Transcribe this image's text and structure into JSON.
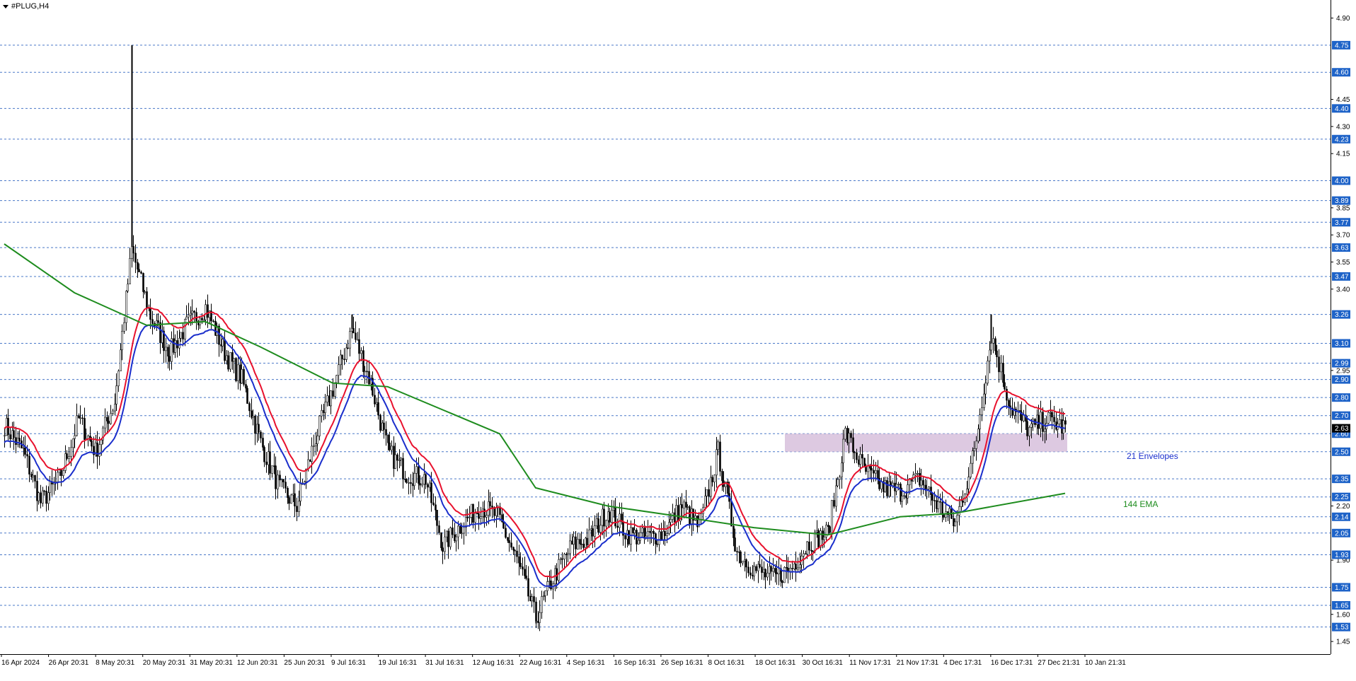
{
  "window": {
    "symbol": "#PLUG,H4"
  },
  "colors": {
    "candle": "#000000",
    "grid": "#4a78c8",
    "upper_band": "#e8112d",
    "lower_band": "#1a2ecc",
    "ema": "#1e8c1e",
    "zone": "#d7bfdc",
    "axis": "#000000",
    "highlight_label_bg": "#1e63c8"
  },
  "price_axis": {
    "min": 1.38,
    "max": 5.0,
    "tick_labels": [
      "4.90",
      "4.45",
      "4.30",
      "4.15",
      "3.85",
      "3.70",
      "3.55",
      "3.40",
      "2.95",
      "2.20",
      "1.90",
      "1.60",
      "1.45"
    ],
    "level_labels": [
      "4.75",
      "4.60",
      "4.40",
      "4.23",
      "4.00",
      "3.89",
      "3.77",
      "3.63",
      "3.47",
      "3.26",
      "3.10",
      "2.99",
      "2.90",
      "2.80",
      "2.70",
      "2.60",
      "2.50",
      "2.35",
      "2.25",
      "2.14",
      "2.05",
      "1.93",
      "1.75",
      "1.65",
      "1.53"
    ],
    "current_price": "2.63"
  },
  "time_axis": {
    "labels": [
      "16 Apr 2024",
      "26 Apr 20:31",
      "8 May 20:31",
      "20 May 20:31",
      "31 May 20:31",
      "12 Jun 20:31",
      "25 Jun 20:31",
      "9 Jul 16:31",
      "19 Jul 16:31",
      "31 Jul 16:31",
      "12 Aug 16:31",
      "22 Aug 16:31",
      "4 Sep 16:31",
      "16 Sep 16:31",
      "26 Sep 16:31",
      "8 Oct 16:31",
      "18 Oct 16:31",
      "30 Oct 16:31",
      "11 Nov 17:31",
      "21 Nov 17:31",
      "4 Dec 17:31",
      "16 Dec 17:31",
      "27 Dec 21:31",
      "10 Jan 21:31"
    ]
  },
  "zone": {
    "from": 2.5,
    "to": 2.6
  },
  "annotations": {
    "envelopes_label": "21 Envelopes",
    "ema_label": "144 EMA"
  },
  "chart_data": {
    "type": "candlestick",
    "series": [
      {
        "name": "21 Envelopes"
      },
      {
        "name": "144 EMA"
      }
    ],
    "keypoints": [
      {
        "date": "16 Apr 2024",
        "close": 2.65
      },
      {
        "date": "20 Apr",
        "close": 2.5
      },
      {
        "date": "24 Apr",
        "close": 2.22
      },
      {
        "date": "28 Apr",
        "close": 2.35
      },
      {
        "date": "2 May",
        "close": 2.68
      },
      {
        "date": "6 May",
        "close": 2.5
      },
      {
        "date": "8 May",
        "close": 2.78
      },
      {
        "date": "10 May",
        "close": 3.62
      },
      {
        "date": "14 May",
        "close": 3.25
      },
      {
        "date": "20 May",
        "close": 3.05
      },
      {
        "date": "26 May",
        "close": 3.2
      },
      {
        "date": "31 May",
        "close": 3.3
      },
      {
        "date": "6 Jun",
        "close": 3.05
      },
      {
        "date": "12 Jun",
        "close": 2.9
      },
      {
        "date": "18 Jun",
        "close": 2.55
      },
      {
        "date": "25 Jun",
        "close": 2.3
      },
      {
        "date": "30 Jun",
        "close": 2.2
      },
      {
        "date": "4 Jul",
        "close": 2.58
      },
      {
        "date": "9 Jul",
        "close": 2.85
      },
      {
        "date": "13 Jul",
        "close": 3.18
      },
      {
        "date": "16 Jul",
        "close": 2.88
      },
      {
        "date": "19 Jul",
        "close": 2.5
      },
      {
        "date": "25 Jul",
        "close": 2.38
      },
      {
        "date": "31 Jul",
        "close": 2.35
      },
      {
        "date": "5 Aug",
        "close": 1.98
      },
      {
        "date": "12 Aug",
        "close": 2.1
      },
      {
        "date": "17 Aug",
        "close": 2.2
      },
      {
        "date": "22 Aug",
        "close": 2.14
      },
      {
        "date": "28 Aug",
        "close": 1.9
      },
      {
        "date": "4 Sep",
        "close": 1.58
      },
      {
        "date": "8 Sep",
        "close": 1.8
      },
      {
        "date": "16 Sep",
        "close": 1.98
      },
      {
        "date": "22 Sep",
        "close": 2.02
      },
      {
        "date": "26 Sep",
        "close": 2.18
      },
      {
        "date": "2 Oct",
        "close": 2.05
      },
      {
        "date": "8 Oct",
        "close": 2.02
      },
      {
        "date": "14 Oct",
        "close": 2.05
      },
      {
        "date": "18 Oct",
        "close": 2.2
      },
      {
        "date": "24 Oct",
        "close": 2.08
      },
      {
        "date": "30 Oct",
        "close": 2.5
      },
      {
        "date": "3 Nov",
        "close": 1.95
      },
      {
        "date": "11 Nov",
        "close": 1.85
      },
      {
        "date": "16 Nov",
        "close": 1.8
      },
      {
        "date": "21 Nov",
        "close": 1.85
      },
      {
        "date": "27 Nov",
        "close": 2.0
      },
      {
        "date": "1 Dec",
        "close": 2.05
      },
      {
        "date": "4 Dec",
        "close": 2.6
      },
      {
        "date": "8 Dec",
        "close": 2.4
      },
      {
        "date": "12 Dec",
        "close": 2.3
      },
      {
        "date": "16 Dec",
        "close": 2.28
      },
      {
        "date": "20 Dec",
        "close": 2.35
      },
      {
        "date": "24 Dec",
        "close": 2.2
      },
      {
        "date": "27 Dec",
        "close": 2.1
      },
      {
        "date": "30 Dec",
        "close": 2.5
      },
      {
        "date": "2 Jan",
        "close": 3.15
      },
      {
        "date": "5 Jan",
        "close": 2.75
      },
      {
        "date": "8 Jan",
        "close": 2.62
      },
      {
        "date": "10 Jan",
        "close": 2.68
      },
      {
        "date": "12 Jan",
        "close": 2.63
      }
    ],
    "extremes": [
      {
        "date": "10 May",
        "high": 4.75
      },
      {
        "date": "13 Jul",
        "high": 3.26
      },
      {
        "date": "4 Sep",
        "low": 1.55
      },
      {
        "date": "2 Jan",
        "high": 3.26
      }
    ],
    "ema_keypoints": [
      {
        "date": "16 Apr 2024",
        "value": 3.65
      },
      {
        "date": "1 May",
        "value": 3.38
      },
      {
        "date": "12 May",
        "value": 3.2
      },
      {
        "date": "31 May",
        "value": 3.22
      },
      {
        "date": "18 Jun",
        "value": 3.08
      },
      {
        "date": "9 Jul",
        "value": 2.88
      },
      {
        "date": "19 Jul",
        "value": 2.86
      },
      {
        "date": "8 Aug",
        "value": 2.6
      },
      {
        "date": "4 Sep",
        "value": 2.3
      },
      {
        "date": "26 Sep",
        "value": 2.2
      },
      {
        "date": "18 Oct",
        "value": 2.14
      },
      {
        "date": "11 Nov",
        "value": 2.08
      },
      {
        "date": "1 Dec",
        "value": 2.04
      },
      {
        "date": "16 Dec",
        "value": 2.14
      },
      {
        "date": "27 Dec",
        "value": 2.16
      },
      {
        "date": "12 Jan",
        "value": 2.27
      }
    ],
    "envelope_width_pct": 1.5
  }
}
